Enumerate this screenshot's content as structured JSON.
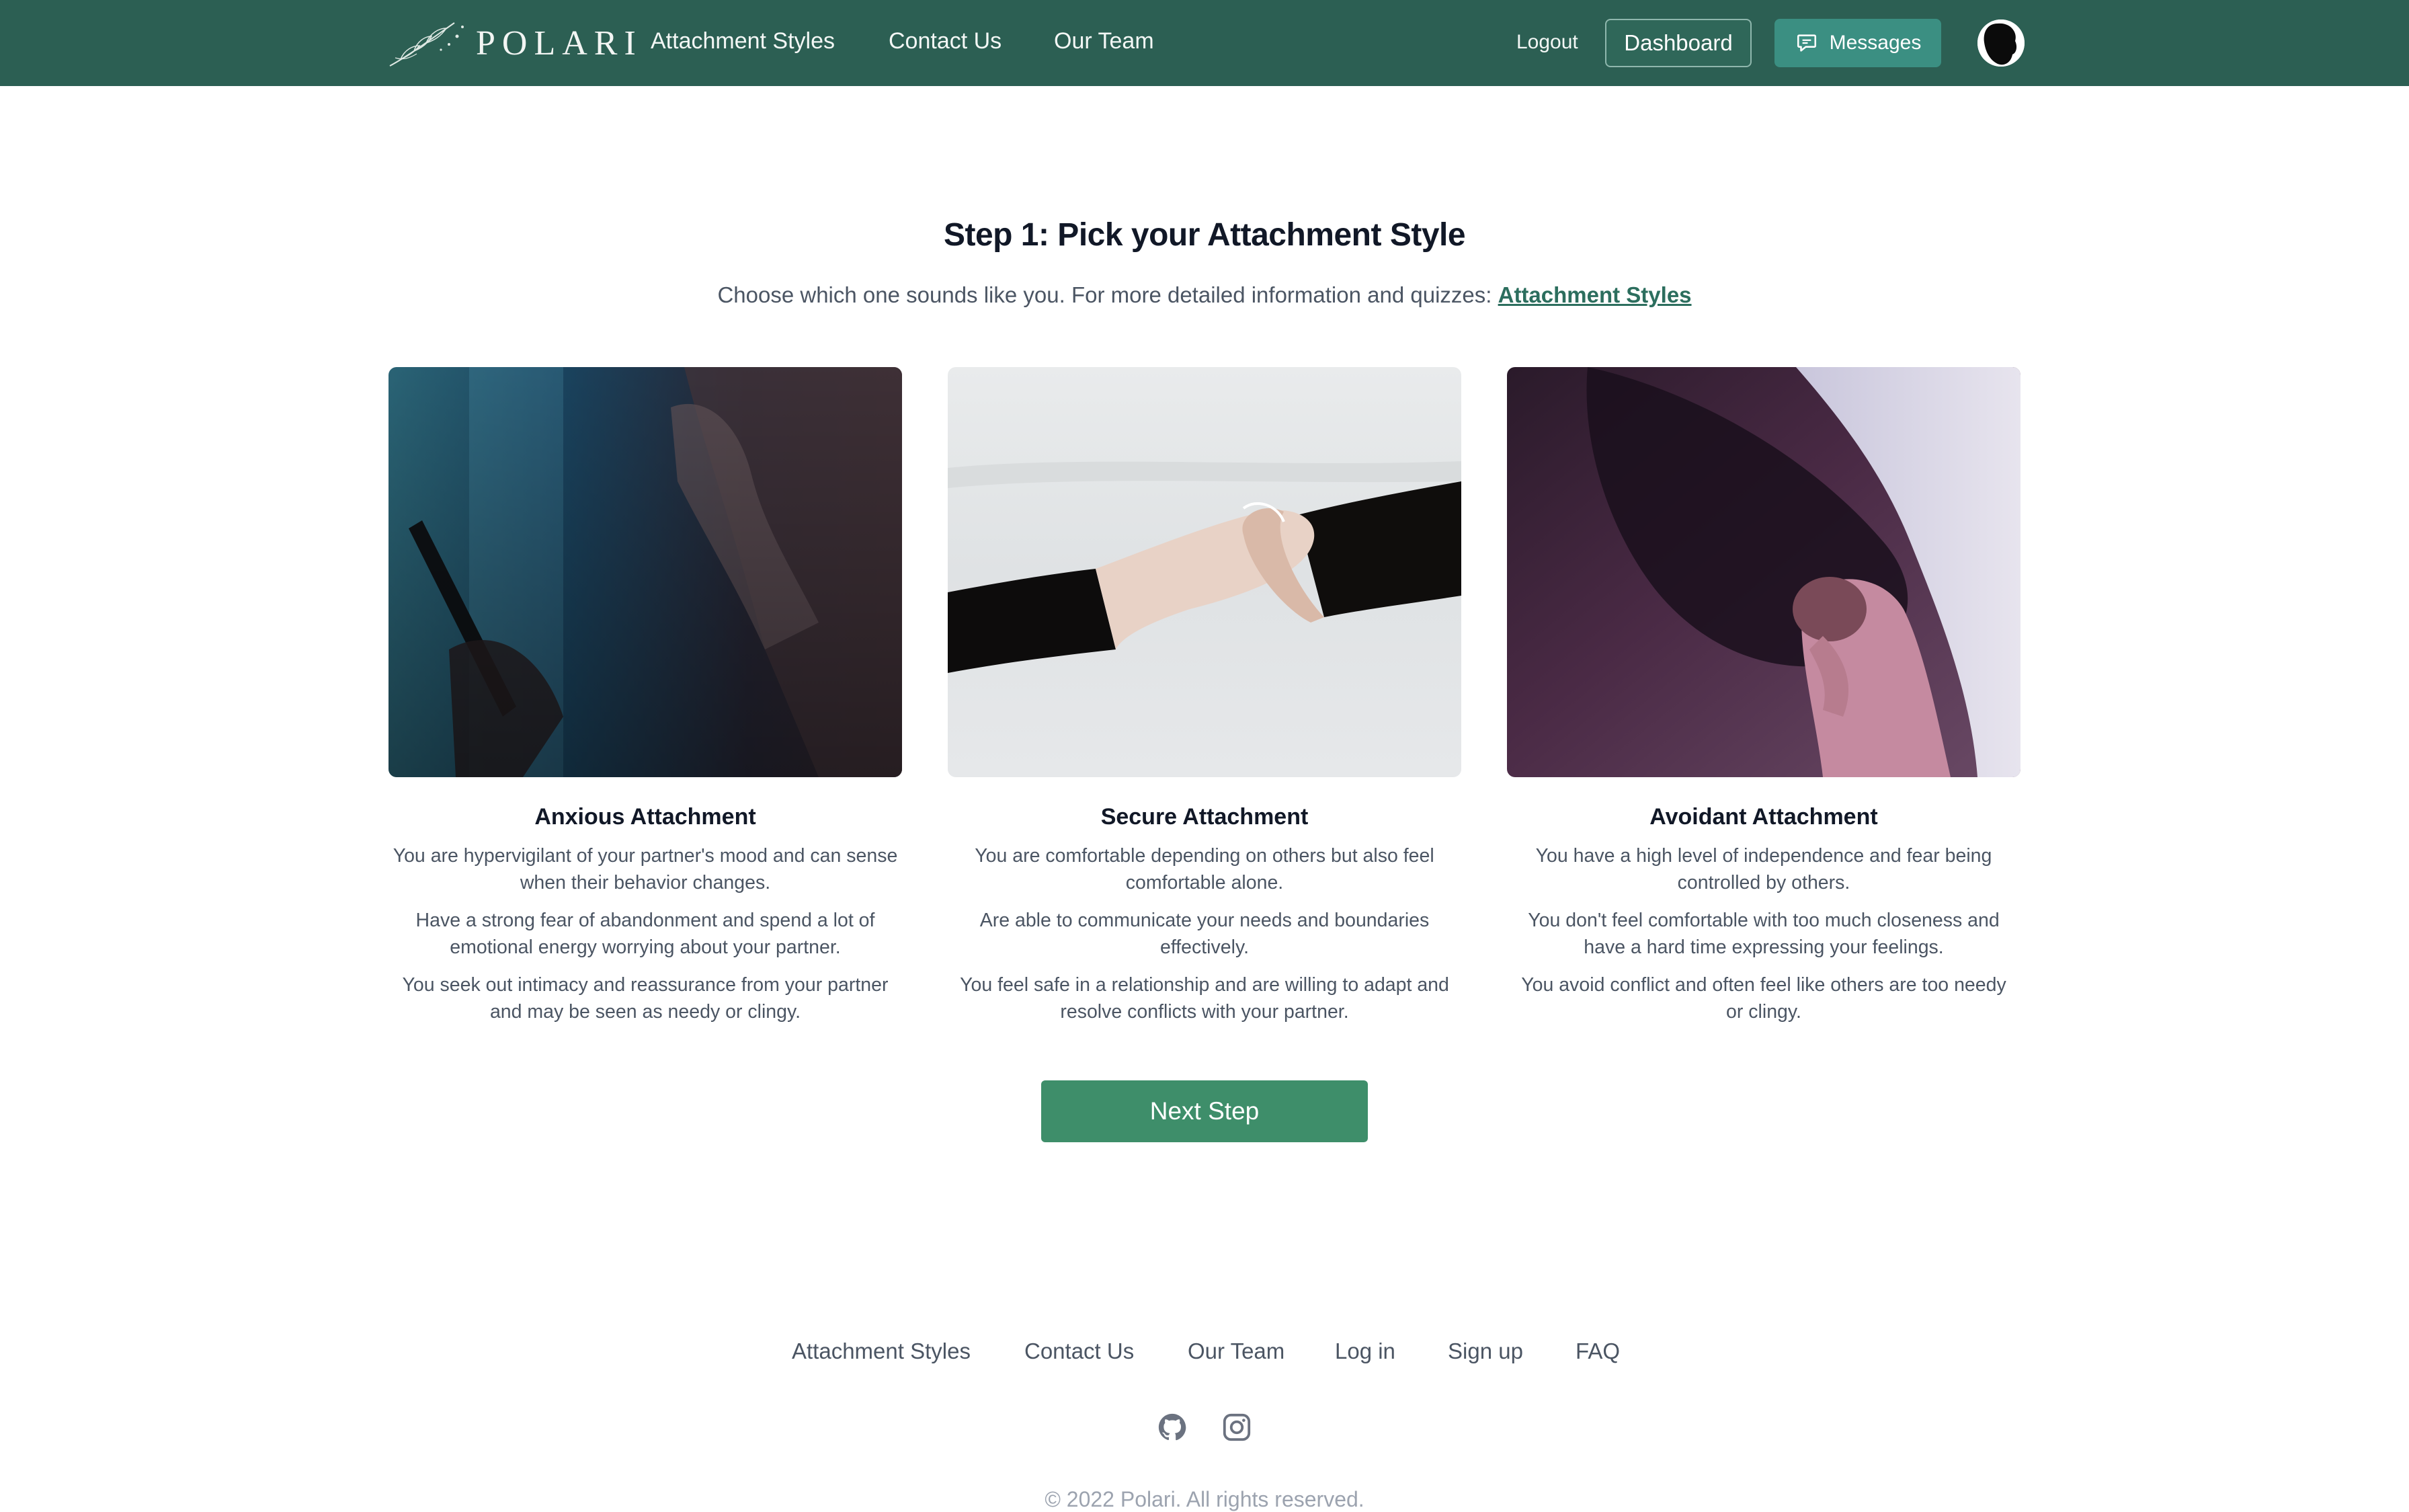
{
  "nav": {
    "brand": "POLARI",
    "links": [
      "Attachment Styles",
      "Contact Us",
      "Our Team"
    ],
    "logout": "Logout",
    "dashboard": "Dashboard",
    "messages": "Messages",
    "colors": {
      "bar": "#2c5f53",
      "messages_bg": "#3b8f82"
    }
  },
  "hero": {
    "title": "Step 1: Pick your Attachment Style",
    "subtitle": "Choose which one sounds like you. For more detailed information and quizzes:",
    "link": "Attachment Styles"
  },
  "cards": [
    {
      "title": "Anxious Attachment",
      "paragraphs": [
        "You are hypervigilant of your partner's mood and can sense when their behavior changes.",
        "Have a strong fear of abandonment and spend a lot of emotional energy worrying about your partner.",
        "You seek out intimacy and reassurance from your partner and may be seen as needy or clingy."
      ]
    },
    {
      "title": "Secure Attachment",
      "paragraphs": [
        "You are comfortable depending on others but also feel comfortable alone.",
        "Are able to communicate your needs and boundaries effectively.",
        "You feel safe in a relationship and are willing to adapt and resolve conflicts with your partner."
      ]
    },
    {
      "title": "Avoidant Attachment",
      "paragraphs": [
        "You have a high level of independence and fear being controlled by others.",
        "You don't feel comfortable with too much closeness and have a hard time expressing your feelings.",
        "You avoid conflict and often feel like others are too needy or clingy."
      ]
    }
  ],
  "next_button": "Next Step",
  "footer": {
    "links": [
      "Attachment Styles",
      "Contact Us",
      "Our Team",
      "Log in",
      "Sign up",
      "FAQ"
    ],
    "icons": [
      "github-icon",
      "instagram-icon"
    ],
    "copyright": "© 2022 Polari. All rights reserved."
  }
}
